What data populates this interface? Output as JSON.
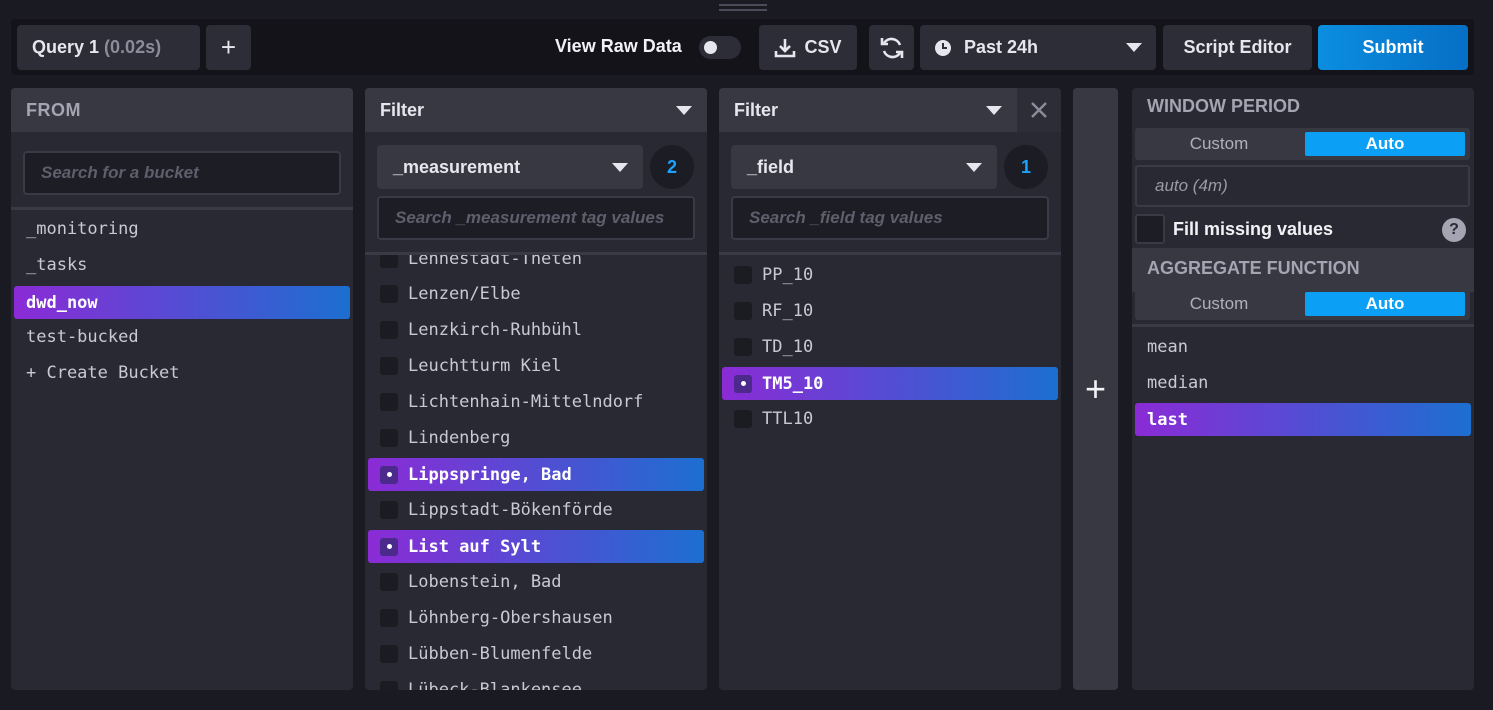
{
  "toolbar": {
    "query_name": "Query 1",
    "query_time": "(0.02s)",
    "add_query": "+",
    "view_raw_label": "View Raw Data",
    "view_raw_on": false,
    "csv_label": "CSV",
    "time_range": "Past 24h",
    "script_editor": "Script Editor",
    "submit": "Submit"
  },
  "from": {
    "title": "FROM",
    "search_placeholder": "Search for a bucket",
    "buckets": [
      "_monitoring",
      "_tasks",
      "dwd_now",
      "test-bucked",
      "+ Create Bucket"
    ],
    "selected": "dwd_now"
  },
  "filter1": {
    "title": "Filter",
    "key": "_measurement",
    "count": "2",
    "search_placeholder": "Search _measurement tag values",
    "values": [
      {
        "label": "Lennestadt-Theten",
        "checked": false
      },
      {
        "label": "Lenzen/Elbe",
        "checked": false
      },
      {
        "label": "Lenzkirch-Ruhbühl",
        "checked": false
      },
      {
        "label": "Leuchtturm Kiel",
        "checked": false
      },
      {
        "label": "Lichtenhain-Mittelndorf",
        "checked": false
      },
      {
        "label": "Lindenberg",
        "checked": false
      },
      {
        "label": "Lippspringe, Bad",
        "checked": true
      },
      {
        "label": "Lippstadt-Bökenförde",
        "checked": false
      },
      {
        "label": "List auf Sylt",
        "checked": true
      },
      {
        "label": "Lobenstein, Bad",
        "checked": false
      },
      {
        "label": "Löhnberg-Obershausen",
        "checked": false
      },
      {
        "label": "Lübben-Blumenfelde",
        "checked": false
      },
      {
        "label": "Lübeck-Blankensee",
        "checked": false
      }
    ]
  },
  "filter2": {
    "title": "Filter",
    "key": "_field",
    "count": "1",
    "search_placeholder": "Search _field tag values",
    "values": [
      {
        "label": "PP_10",
        "checked": false
      },
      {
        "label": "RF_10",
        "checked": false
      },
      {
        "label": "TD_10",
        "checked": false
      },
      {
        "label": "TM5_10",
        "checked": true
      },
      {
        "label": "TTL10",
        "checked": false
      }
    ]
  },
  "add_filter": "+",
  "aggregate": {
    "window_title": "WINDOW PERIOD",
    "custom_label": "Custom",
    "auto_label": "Auto",
    "period_value": "auto (4m)",
    "fill_missing_label": "Fill missing values",
    "help": "?",
    "function_title": "AGGREGATE FUNCTION",
    "functions": [
      "mean",
      "median",
      "last"
    ],
    "selected": "last"
  },
  "colors": {
    "accent": "#0ba0f5",
    "selection_start": "#8b2bd6",
    "selection_end": "#1c6fd0"
  }
}
